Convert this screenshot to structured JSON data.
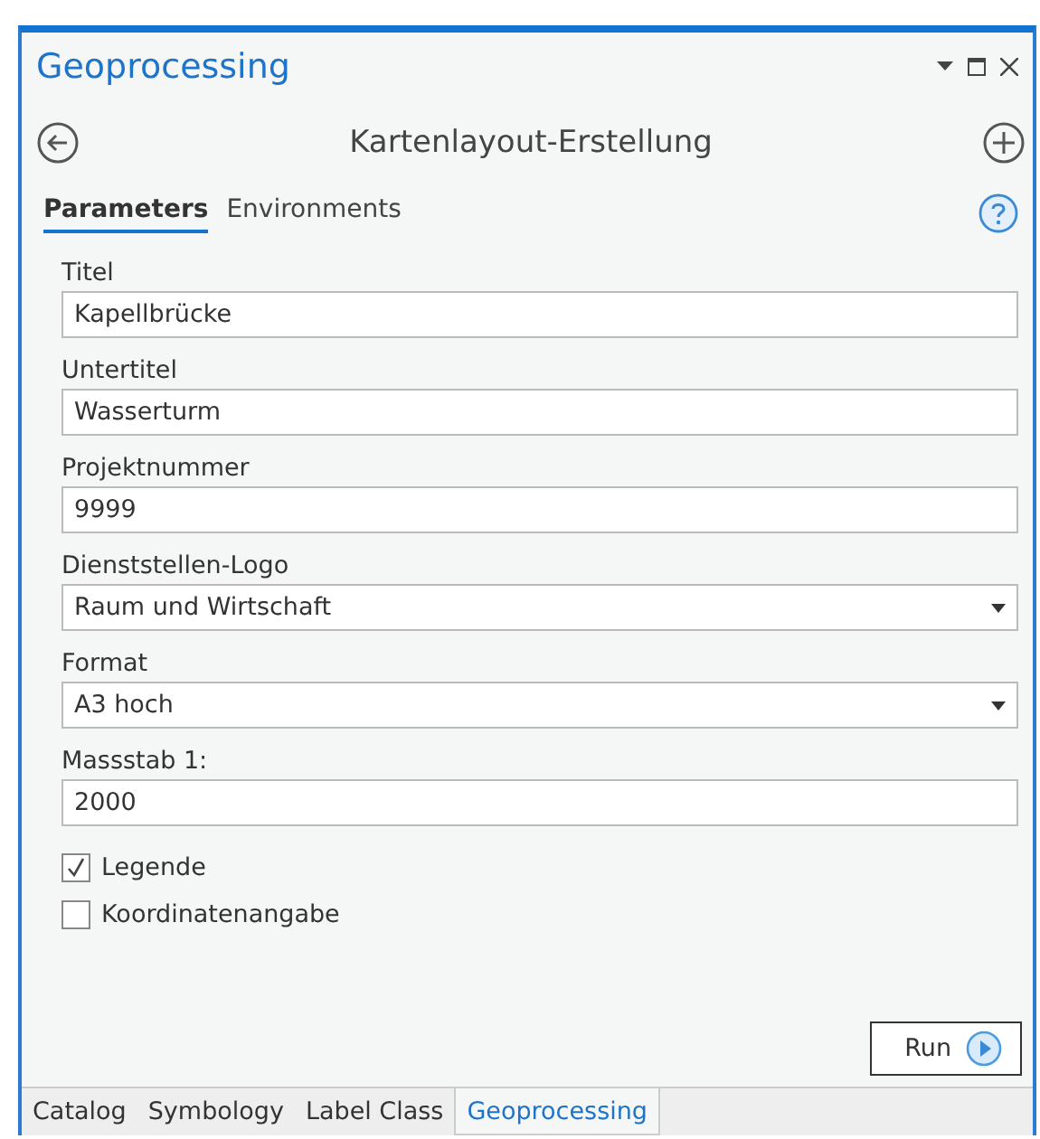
{
  "pane": {
    "title": "Geoprocessing"
  },
  "tool": {
    "title": "Kartenlayout-Erstellung"
  },
  "tabs": [
    {
      "label": "Parameters",
      "selected": true
    },
    {
      "label": "Environments",
      "selected": false
    }
  ],
  "parameters": [
    {
      "kind": "text",
      "label": "Titel",
      "value": "Kapellbrücke"
    },
    {
      "kind": "text",
      "label": "Untertitel",
      "value": "Wasserturm"
    },
    {
      "kind": "text",
      "label": "Projektnummer",
      "value": "9999"
    },
    {
      "kind": "dropdown",
      "label": "Dienststellen-Logo",
      "value": "Raum und Wirtschaft"
    },
    {
      "kind": "dropdown",
      "label": "Format",
      "value": "A3 hoch"
    },
    {
      "kind": "text",
      "label": "Massstab 1:",
      "value": "2000"
    }
  ],
  "options": [
    {
      "label": "Legende",
      "checked": true
    },
    {
      "label": "Koordinatenangabe",
      "checked": false
    }
  ],
  "run_button": {
    "label": "Run"
  },
  "bottom_tabs": [
    {
      "label": "Catalog",
      "selected": false
    },
    {
      "label": "Symbology",
      "selected": false
    },
    {
      "label": "Label Class",
      "selected": false
    },
    {
      "label": "Geoprocessing",
      "selected": true
    }
  ]
}
